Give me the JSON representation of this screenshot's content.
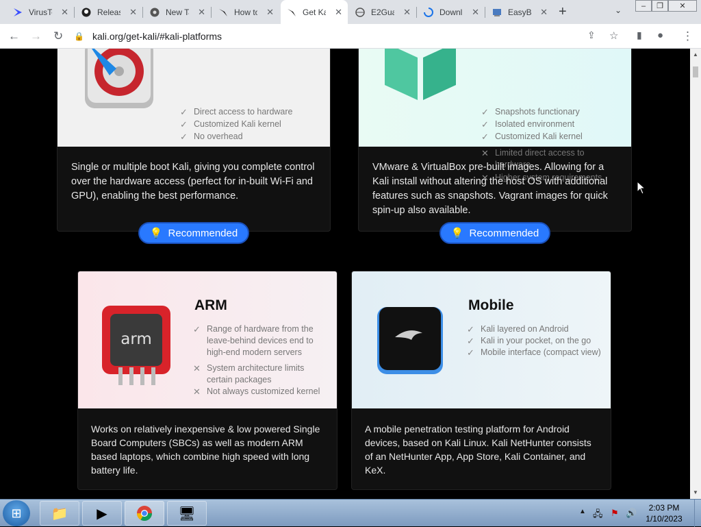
{
  "browser": {
    "tabs": [
      {
        "title": "VirusTo",
        "icon": "virustotal-icon"
      },
      {
        "title": "Releas",
        "icon": "github-icon"
      },
      {
        "title": "New Ta",
        "icon": "chrome-icon"
      },
      {
        "title": "How to",
        "icon": "kali-dragon-icon"
      },
      {
        "title": "Get Ka",
        "icon": "kali-dragon-icon",
        "active": true
      },
      {
        "title": "E2Gua",
        "icon": "globe-icon"
      },
      {
        "title": "Downl",
        "icon": "loading-icon"
      },
      {
        "title": "EasyB",
        "icon": "app-icon"
      }
    ],
    "url": "kali.org/get-kali/#kali-platforms"
  },
  "cards_top": [
    {
      "features_ok": [
        "Direct access to hardware",
        "Customized Kali kernel",
        "No overhead"
      ],
      "features_no": [],
      "description": "Single or multiple boot Kali, giving you complete control over the hardware access (perfect for in-built Wi-Fi and GPU), enabling the best performance.",
      "badge": "Recommended",
      "colors": {
        "top": "#f1f1f1"
      }
    },
    {
      "features_ok": [
        "Snapshots functionary",
        "Isolated environment",
        "Customized Kali kernel"
      ],
      "features_no": [
        "Limited direct access to hardware",
        "Higher system requirements"
      ],
      "description": "VMware & VirtualBox pre-built images. Allowing for a Kali install without altering the host OS with additional features such as snapshots. Vagrant images for quick spin-up also available.",
      "badge": "Recommended",
      "colors": {
        "top": "#e6fbf5"
      }
    }
  ],
  "cards_bottom": [
    {
      "title": "ARM",
      "features_ok": [
        "Range of hardware from the leave-behind devices end to high-end modern servers"
      ],
      "features_no": [
        "System architecture limits certain packages",
        "Not always customized kernel"
      ],
      "description": "Works on relatively inexpensive & low powered Single Board Computers (SBCs) as well as modern ARM based laptops, which combine high speed with long battery life.",
      "chip_label": "arm",
      "colors": {
        "top": "#fbe9ec"
      }
    },
    {
      "title": "Mobile",
      "features_ok": [
        "Kali layered on Android",
        "Kali in your pocket, on the go",
        "Mobile interface (compact view)"
      ],
      "features_no": [],
      "description": "A mobile penetration testing platform for Android devices, based on Kali Linux. Kali NetHunter consists of an NetHunter App, App Store, Kali Container, and KeX.",
      "colors": {
        "top": "#e3f1f7"
      }
    }
  ],
  "taskbar": {
    "time": "2:03 PM",
    "date": "1/10/2023",
    "apps": [
      "explorer-icon",
      "media-player-icon",
      "chrome-icon",
      "network-app-icon"
    ]
  },
  "colors": {
    "accent": "#2979ff",
    "page_bg": "#000000"
  }
}
